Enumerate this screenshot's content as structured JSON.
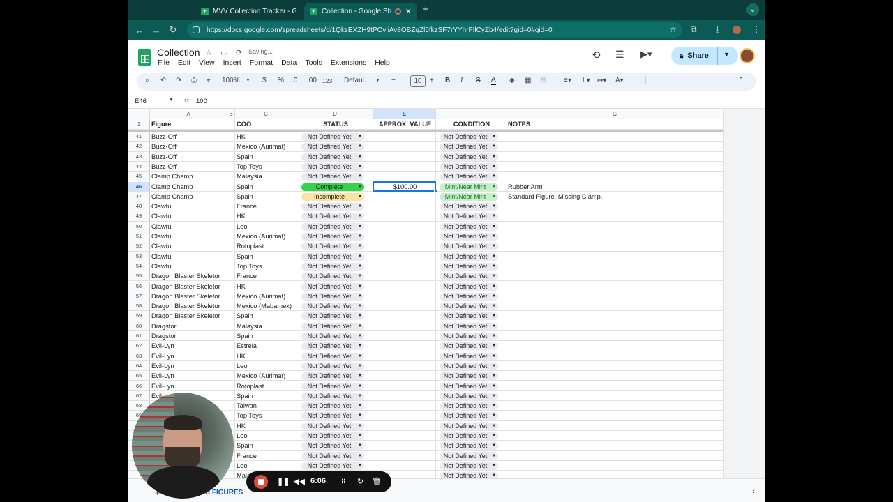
{
  "browser": {
    "tabs": [
      {
        "title": "MVV Collection Tracker - Goo",
        "active": false
      },
      {
        "title": "Collection - Google Sheets",
        "active": true
      }
    ],
    "new_tab": "+",
    "url": "https://docs.google.com/spreadsheets/d/1QksEXZH9tPOviiAv8OBZqZl5fkzSF7rYYhrFIlCyZb4/edit?gid=0#gid=0"
  },
  "doc": {
    "title": "Collection",
    "saving": "Saving...",
    "menus": [
      "File",
      "Edit",
      "View",
      "Insert",
      "Format",
      "Data",
      "Tools",
      "Extensions",
      "Help"
    ],
    "share_label": "Share"
  },
  "toolbar": {
    "zoom": "100%",
    "currency": "$",
    "percent": "%",
    "dec_decrease": ".0",
    "dec_increase": ".00",
    "number_format": "123",
    "font": "Defaul...",
    "font_size": "10",
    "bold": "B",
    "italic": "I",
    "strike": "S",
    "text_color": "A"
  },
  "formula_bar": {
    "name_box": "E46",
    "fx": "fx",
    "value": "100"
  },
  "grid": {
    "columns": [
      "A",
      "B",
      "C",
      "D",
      "E",
      "F",
      "G"
    ],
    "selected_column": "E",
    "header": {
      "row": "1",
      "figure": "Figure",
      "coo": "COO",
      "status": "STATUS",
      "value": "APPROX. VALUE",
      "condition": "CONDITION",
      "notes": "NOTES"
    },
    "rows": [
      {
        "n": "41",
        "figure": "Buzz-Off",
        "coo": "HK",
        "status": "Not Defined Yet",
        "value": "",
        "condition": "Not Defined Yet",
        "notes": ""
      },
      {
        "n": "42",
        "figure": "Buzz-Off",
        "coo": "Mexico (Aurimat)",
        "status": "Not Defined Yet",
        "value": "",
        "condition": "Not Defined Yet",
        "notes": ""
      },
      {
        "n": "43",
        "figure": "Buzz-Off",
        "coo": "Spain",
        "status": "Not Defined Yet",
        "value": "",
        "condition": "Not Defined Yet",
        "notes": ""
      },
      {
        "n": "44",
        "figure": "Buzz-Off",
        "coo": "Top Toys",
        "status": "Not Defined Yet",
        "value": "",
        "condition": "Not Defined Yet",
        "notes": ""
      },
      {
        "n": "45",
        "figure": "Clamp Champ",
        "coo": "Malaysia",
        "status": "Not Defined Yet",
        "value": "",
        "condition": "Not Defined Yet",
        "notes": ""
      },
      {
        "n": "46",
        "figure": "Clamp Champ",
        "coo": "Spain",
        "status": "Complete",
        "value": "$100.00",
        "condition": "Mint/Near Mint",
        "notes": "Rubber Arm"
      },
      {
        "n": "47",
        "figure": "Clamp Champ",
        "coo": "Spain",
        "status": "Incomplete",
        "value": "",
        "condition": "Mint/Near Mint",
        "notes": "Standard Figure. Missing Clamp."
      },
      {
        "n": "48",
        "figure": "Clawful",
        "coo": "France",
        "status": "Not Defined Yet",
        "value": "",
        "condition": "Not Defined Yet",
        "notes": ""
      },
      {
        "n": "49",
        "figure": "Clawful",
        "coo": "HK",
        "status": "Not Defined Yet",
        "value": "",
        "condition": "Not Defined Yet",
        "notes": ""
      },
      {
        "n": "50",
        "figure": "Clawful",
        "coo": "Leo",
        "status": "Not Defined Yet",
        "value": "",
        "condition": "Not Defined Yet",
        "notes": ""
      },
      {
        "n": "51",
        "figure": "Clawful",
        "coo": "Mexico (Aurimat)",
        "status": "Not Defined Yet",
        "value": "",
        "condition": "Not Defined Yet",
        "notes": ""
      },
      {
        "n": "52",
        "figure": "Clawful",
        "coo": "Rotoplast",
        "status": "Not Defined Yet",
        "value": "",
        "condition": "Not Defined Yet",
        "notes": ""
      },
      {
        "n": "53",
        "figure": "Clawful",
        "coo": "Spain",
        "status": "Not Defined Yet",
        "value": "",
        "condition": "Not Defined Yet",
        "notes": ""
      },
      {
        "n": "54",
        "figure": "Clawful",
        "coo": "Top Toys",
        "status": "Not Defined Yet",
        "value": "",
        "condition": "Not Defined Yet",
        "notes": ""
      },
      {
        "n": "55",
        "figure": "Dragon Blaster Skeletor",
        "coo": "France",
        "status": "Not Defined Yet",
        "value": "",
        "condition": "Not Defined Yet",
        "notes": ""
      },
      {
        "n": "56",
        "figure": "Dragon Blaster Skeletor",
        "coo": "HK",
        "status": "Not Defined Yet",
        "value": "",
        "condition": "Not Defined Yet",
        "notes": ""
      },
      {
        "n": "57",
        "figure": "Dragon Blaster Skeletor",
        "coo": "Mexico (Aurimat)",
        "status": "Not Defined Yet",
        "value": "",
        "condition": "Not Defined Yet",
        "notes": ""
      },
      {
        "n": "58",
        "figure": "Dragon Blaster Skeletor",
        "coo": "Mexico (Mabamex)",
        "status": "Not Defined Yet",
        "value": "",
        "condition": "Not Defined Yet",
        "notes": ""
      },
      {
        "n": "59",
        "figure": "Dragon Blaster Skeletor",
        "coo": "Spain",
        "status": "Not Defined Yet",
        "value": "",
        "condition": "Not Defined Yet",
        "notes": ""
      },
      {
        "n": "60",
        "figure": "Dragstor",
        "coo": "Malaysia",
        "status": "Not Defined Yet",
        "value": "",
        "condition": "Not Defined Yet",
        "notes": ""
      },
      {
        "n": "61",
        "figure": "Dragstor",
        "coo": "Spain",
        "status": "Not Defined Yet",
        "value": "",
        "condition": "Not Defined Yet",
        "notes": ""
      },
      {
        "n": "62",
        "figure": "Evil-Lyn",
        "coo": "Estrela",
        "status": "Not Defined Yet",
        "value": "",
        "condition": "Not Defined Yet",
        "notes": ""
      },
      {
        "n": "63",
        "figure": "Evil-Lyn",
        "coo": "HK",
        "status": "Not Defined Yet",
        "value": "",
        "condition": "Not Defined Yet",
        "notes": ""
      },
      {
        "n": "64",
        "figure": "Evil-Lyn",
        "coo": "Leo",
        "status": "Not Defined Yet",
        "value": "",
        "condition": "Not Defined Yet",
        "notes": ""
      },
      {
        "n": "65",
        "figure": "Evil-Lyn",
        "coo": "Mexico (Aurimat)",
        "status": "Not Defined Yet",
        "value": "",
        "condition": "Not Defined Yet",
        "notes": ""
      },
      {
        "n": "66",
        "figure": "Evil-Lyn",
        "coo": "Rotoplast",
        "status": "Not Defined Yet",
        "value": "",
        "condition": "Not Defined Yet",
        "notes": ""
      },
      {
        "n": "67",
        "figure": "Evil-Lyn",
        "coo": "Spain",
        "status": "Not Defined Yet",
        "value": "",
        "condition": "Not Defined Yet",
        "notes": ""
      },
      {
        "n": "68",
        "figure": "E",
        "coo": "Taiwan",
        "status": "Not Defined Yet",
        "value": "",
        "condition": "Not Defined Yet",
        "notes": ""
      },
      {
        "n": "69",
        "figure": "",
        "coo": "Top Toys",
        "status": "Not Defined Yet",
        "value": "",
        "condition": "Not Defined Yet",
        "notes": ""
      },
      {
        "n": "",
        "figure": "",
        "coo": "HK",
        "status": "Not Defined Yet",
        "value": "",
        "condition": "Not Defined Yet",
        "notes": ""
      },
      {
        "n": "",
        "figure": "",
        "coo": "Leo",
        "status": "Not Defined Yet",
        "value": "",
        "condition": "Not Defined Yet",
        "notes": ""
      },
      {
        "n": "",
        "figure": "",
        "coo": "Spain",
        "status": "Not Defined Yet",
        "value": "",
        "condition": "Not Defined Yet",
        "notes": ""
      },
      {
        "n": "",
        "figure": "",
        "coo": "France",
        "status": "Not Defined Yet",
        "value": "",
        "condition": "Not Defined Yet",
        "notes": ""
      },
      {
        "n": "",
        "figure": "",
        "coo": "Leo",
        "status": "Not Defined Yet",
        "value": "",
        "condition": "Not Defined Yet",
        "notes": ""
      },
      {
        "n": "",
        "figure": "",
        "coo": "Malay",
        "status": "",
        "value": "",
        "condition": "Not Defined Yet",
        "notes": ""
      }
    ]
  },
  "bottom": {
    "add_sheet": "+",
    "sheet_tab": "OTU FIGURES"
  },
  "recorder": {
    "time": "6:06"
  },
  "colors": {
    "complete": "#34d34a",
    "incomplete": "#fbe2a6",
    "mint": "#c8f0c8",
    "not_defined": "#e8eaed",
    "selection": "#1a73e8"
  }
}
